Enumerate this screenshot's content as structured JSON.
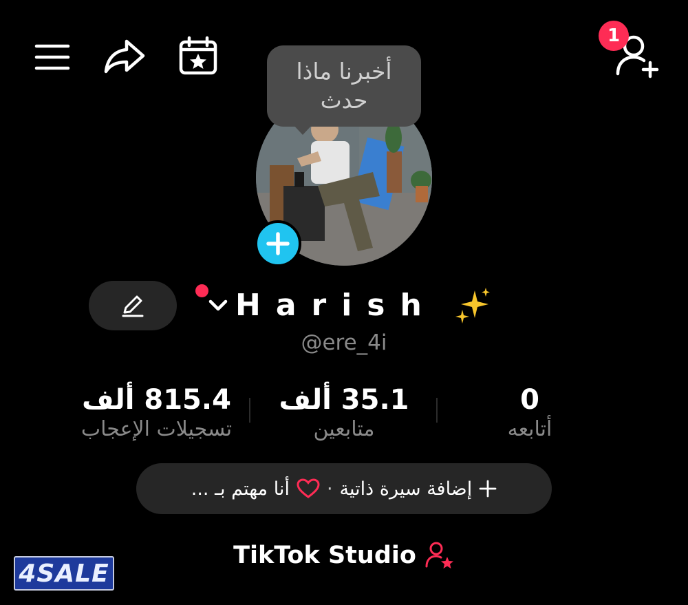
{
  "header": {
    "menu_icon": "hamburger-icon",
    "share_icon": "share-arrow-icon",
    "calendar_icon": "calendar-star-icon",
    "add_friend_icon": "person-add-icon",
    "notification_count": "1"
  },
  "tooltip": {
    "text": "أخبرنا ماذا حدث"
  },
  "profile": {
    "display_name": "Harish",
    "username": "@ere_4i",
    "has_new_dot": true
  },
  "stats": {
    "likes": {
      "value": "815.4 ألف",
      "label": "تسجيلات الإعجاب"
    },
    "followers": {
      "value": "35.1 ألف",
      "label": "متابعين"
    },
    "following": {
      "value": "0",
      "label": "أتابعه"
    }
  },
  "bio": {
    "add_label": "إضافة سيرة ذاتية",
    "separator": "·",
    "interest_label": "أنا مهتم بـ ..."
  },
  "studio": {
    "label": "TikTok Studio"
  },
  "watermark": {
    "text": "4SALE"
  },
  "colors": {
    "accent": "#fe2c55",
    "avatar_plus": "#20c4f0",
    "pill_bg": "#262626",
    "muted_text": "#8a8a8a"
  }
}
